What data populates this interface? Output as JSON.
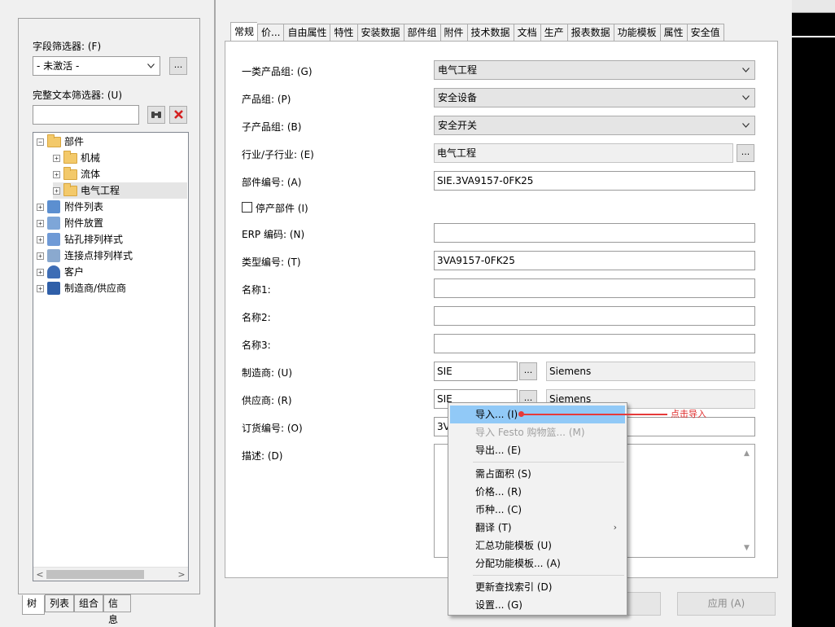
{
  "left_panel": {
    "field_filter_label": "字段筛选器: (F)",
    "field_filter_value": "- 未激活 -",
    "more_button": "...",
    "fulltext_filter_label": "完整文本筛选器: (U)",
    "fulltext_filter_value": "",
    "tree": [
      {
        "label": "部件",
        "expanded": true
      },
      {
        "label": "机械"
      },
      {
        "label": "流体"
      },
      {
        "label": "电气工程",
        "selected": true
      },
      {
        "label": "附件列表"
      },
      {
        "label": "附件放置"
      },
      {
        "label": "钻孔排列样式"
      },
      {
        "label": "连接点排列样式"
      },
      {
        "label": "客户"
      },
      {
        "label": "制造商/供应商"
      }
    ],
    "bottom_tabs": [
      "树",
      "列表",
      "组合",
      "信息"
    ]
  },
  "tabs": [
    "常规",
    "价...",
    "自由属性",
    "特性",
    "安装数据",
    "部件组",
    "附件",
    "技术数据",
    "文档",
    "生产",
    "报表数据",
    "功能模板",
    "属性",
    "安全值"
  ],
  "form": {
    "product_group_1": {
      "label": "一类产品组: (G)",
      "value": "电气工程"
    },
    "product_group": {
      "label": "产品组: (P)",
      "value": "安全设备"
    },
    "sub_product_group": {
      "label": "子产品组: (B)",
      "value": "安全开关"
    },
    "industry": {
      "label": "行业/子行业: (E)",
      "value": "电气工程"
    },
    "part_number": {
      "label": "部件编号: (A)",
      "value": "SIE.3VA9157-0FK25"
    },
    "discontinued": {
      "label": "停产部件 (I)",
      "checked": false
    },
    "erp_code": {
      "label": "ERP 编码: (N)",
      "value": ""
    },
    "type_number": {
      "label": "类型编号: (T)",
      "value": "3VA9157-0FK25"
    },
    "name1": {
      "label": "名称1:",
      "value": ""
    },
    "name2": {
      "label": "名称2:",
      "value": ""
    },
    "name3": {
      "label": "名称3:",
      "value": ""
    },
    "manufacturer": {
      "label": "制造商: (U)",
      "code": "SIE",
      "name": "Siemens"
    },
    "supplier": {
      "label": "供应商: (R)",
      "code": "SIE",
      "name": "Siemens"
    },
    "order_number": {
      "label": "订货编号: (O)",
      "value": "3V"
    },
    "description": {
      "label": "描述: (D)",
      "value": ""
    }
  },
  "buttons": {
    "apply": "应用 (A)"
  },
  "context_menu": [
    {
      "label": "导入... (I)",
      "highlighted": true
    },
    {
      "label": "导入 Festo 购物篮... (M)",
      "disabled": true
    },
    {
      "label": "导出... (E)"
    },
    {
      "label": "需占面积 (S)"
    },
    {
      "label": "价格... (R)"
    },
    {
      "label": "币种... (C)"
    },
    {
      "label": "翻译 (T)",
      "submenu": true
    },
    {
      "label": "汇总功能模板 (U)"
    },
    {
      "label": "分配功能模板... (A)"
    },
    {
      "label": "更新查找索引 (D)"
    },
    {
      "label": "设置... (G)"
    }
  ],
  "annotation": "点击导入",
  "colors": {
    "highlight": "#91c9f7",
    "annotation": "#e63a3a",
    "folder": "#f3c96a"
  }
}
